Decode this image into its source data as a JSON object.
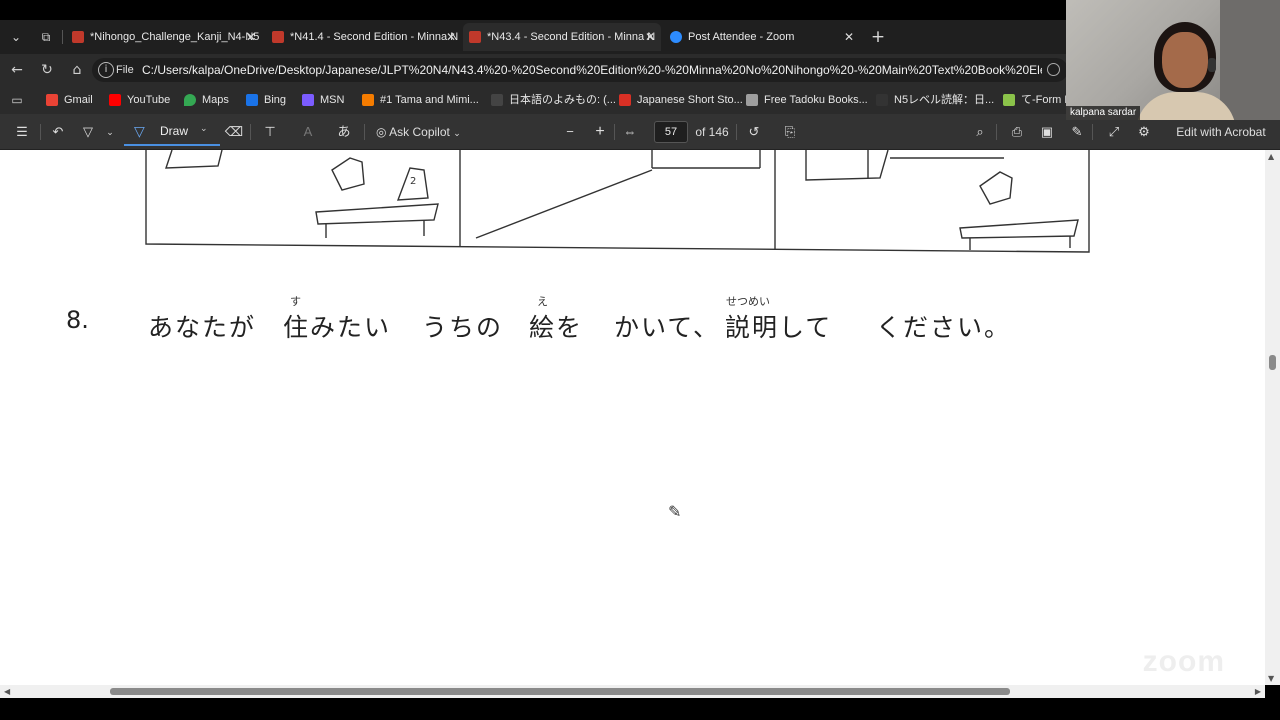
{
  "browser": {
    "tabs": [
      {
        "title": "*Nihongo_Challenge_Kanji_N4-N5",
        "active": false
      },
      {
        "title": "*N41.4 - Second Edition - Minna N",
        "active": false
      },
      {
        "title": "*N43.4 - Second Edition - Minna N",
        "active": true
      },
      {
        "title": "Post Attendee - Zoom",
        "active": false
      }
    ],
    "new_tab_label": "+",
    "address": {
      "protocol": "File",
      "url": "C:/Users/kalpa/OneDrive/Desktop/Japanese/JLPT%20N4/N43.4%20-%20Second%20Edition%20-%20Minna%20No%20Nihongo%20-%20Main%20Text%20Book%20Element..."
    },
    "bookmarks": [
      {
        "label": "Gmail",
        "color": "#ea4335"
      },
      {
        "label": "YouTube",
        "color": "#ff0000"
      },
      {
        "label": "Maps",
        "color": "#34a853"
      },
      {
        "label": "Bing",
        "color": "#1a73e8"
      },
      {
        "label": "MSN",
        "color": "#7b5cff"
      },
      {
        "label": "#1 Tama and Mimi...",
        "color": "#f57c00"
      },
      {
        "label": "日本語のよみもの: (...",
        "color": "#444444"
      },
      {
        "label": "Japanese Short Sto...",
        "color": "#d93025"
      },
      {
        "label": "Free Tadoku Books...",
        "color": "#9e9e9e"
      },
      {
        "label": "N5レベル読解：日...",
        "color": "#333333"
      },
      {
        "label": "て-Form Pr",
        "color": "#8bc34a"
      }
    ]
  },
  "pdf_toolbar": {
    "draw_label": "Draw",
    "text_tool_label": "あ",
    "ask_copilot_label": "Ask Copilot",
    "current_page": "57",
    "total_pages_label": "of 146",
    "edit_with_acrobat_label": "Edit with Acrobat"
  },
  "document": {
    "question_number": "8.",
    "segments": [
      {
        "text": "あなたが"
      },
      {
        "text": "住みたい",
        "furigana": "す"
      },
      {
        "text": "うちの"
      },
      {
        "text": "絵を",
        "furigana": "え"
      },
      {
        "text": "かいて、"
      },
      {
        "text": "説明して",
        "furigana": "せつめい"
      },
      {
        "text": "ください。"
      }
    ]
  },
  "watermark": "zoom",
  "participant": {
    "name": "kalpana sardar"
  }
}
